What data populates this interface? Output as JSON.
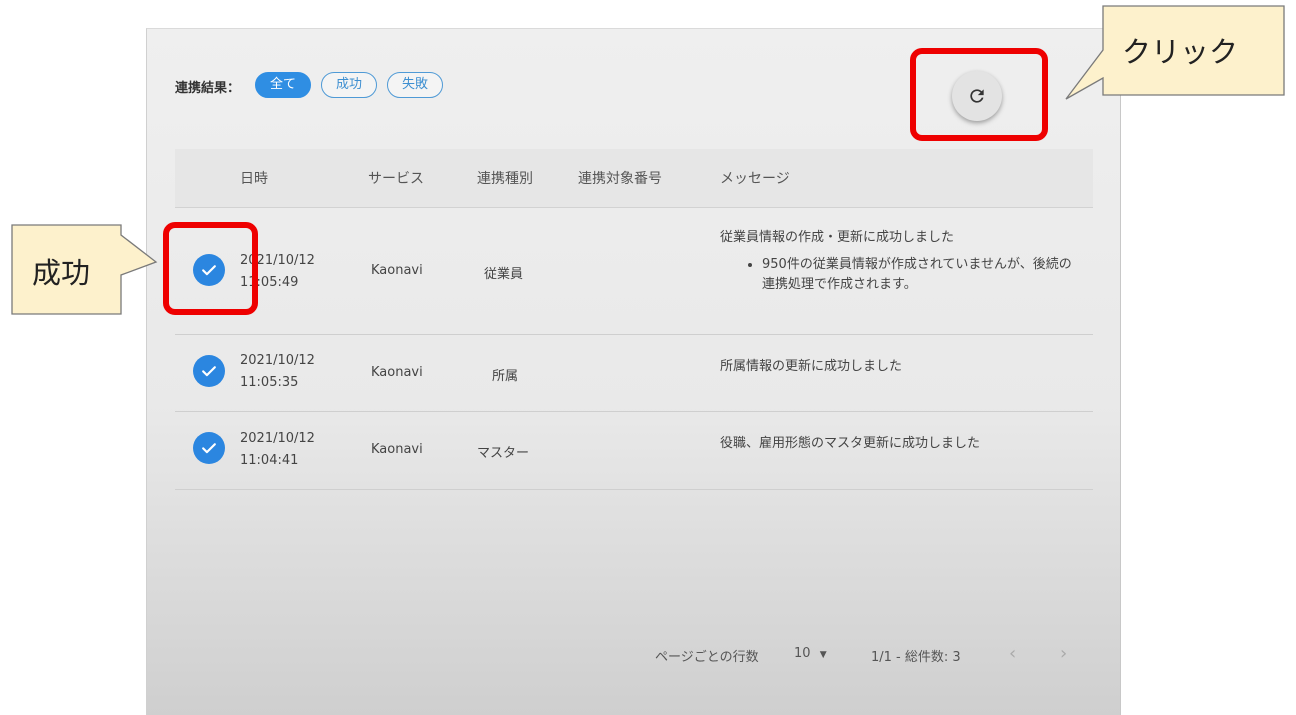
{
  "filter": {
    "label": "連携結果：",
    "chips": [
      "全て",
      "成功",
      "失敗"
    ]
  },
  "table": {
    "headers": [
      "日時",
      "サービス",
      "連携種別",
      "連携対象番号",
      "メッセージ"
    ],
    "rows": [
      {
        "date": "2021/10/12",
        "time": "11:05:49",
        "service": "Kaonavi",
        "kind": "従業員",
        "message": "従業員情報の作成・更新に成功しました",
        "detail": "950件の従業員情報が作成されていませんが、後続の連携処理で作成されます。"
      },
      {
        "date": "2021/10/12",
        "time": "11:05:35",
        "service": "Kaonavi",
        "kind": "所属",
        "message": "所属情報の更新に成功しました"
      },
      {
        "date": "2021/10/12",
        "time": "11:04:41",
        "service": "Kaonavi",
        "kind": "マスター",
        "message": "役職、雇用形態のマスタ更新に成功しました"
      }
    ]
  },
  "pagination": {
    "rows_per_page_label": "ページごとの行数",
    "rows_per_page_value": "10",
    "range_text": "1/1 - 総件数: 3",
    "prev_icon": "‹",
    "next_icon": "›"
  },
  "annotations": {
    "click_callout": "クリック",
    "success_callout": "成功"
  },
  "colors": {
    "accent": "#2f8ee3",
    "annotation_red": "#ee0000",
    "callout_fill": "#fdf1cc"
  }
}
